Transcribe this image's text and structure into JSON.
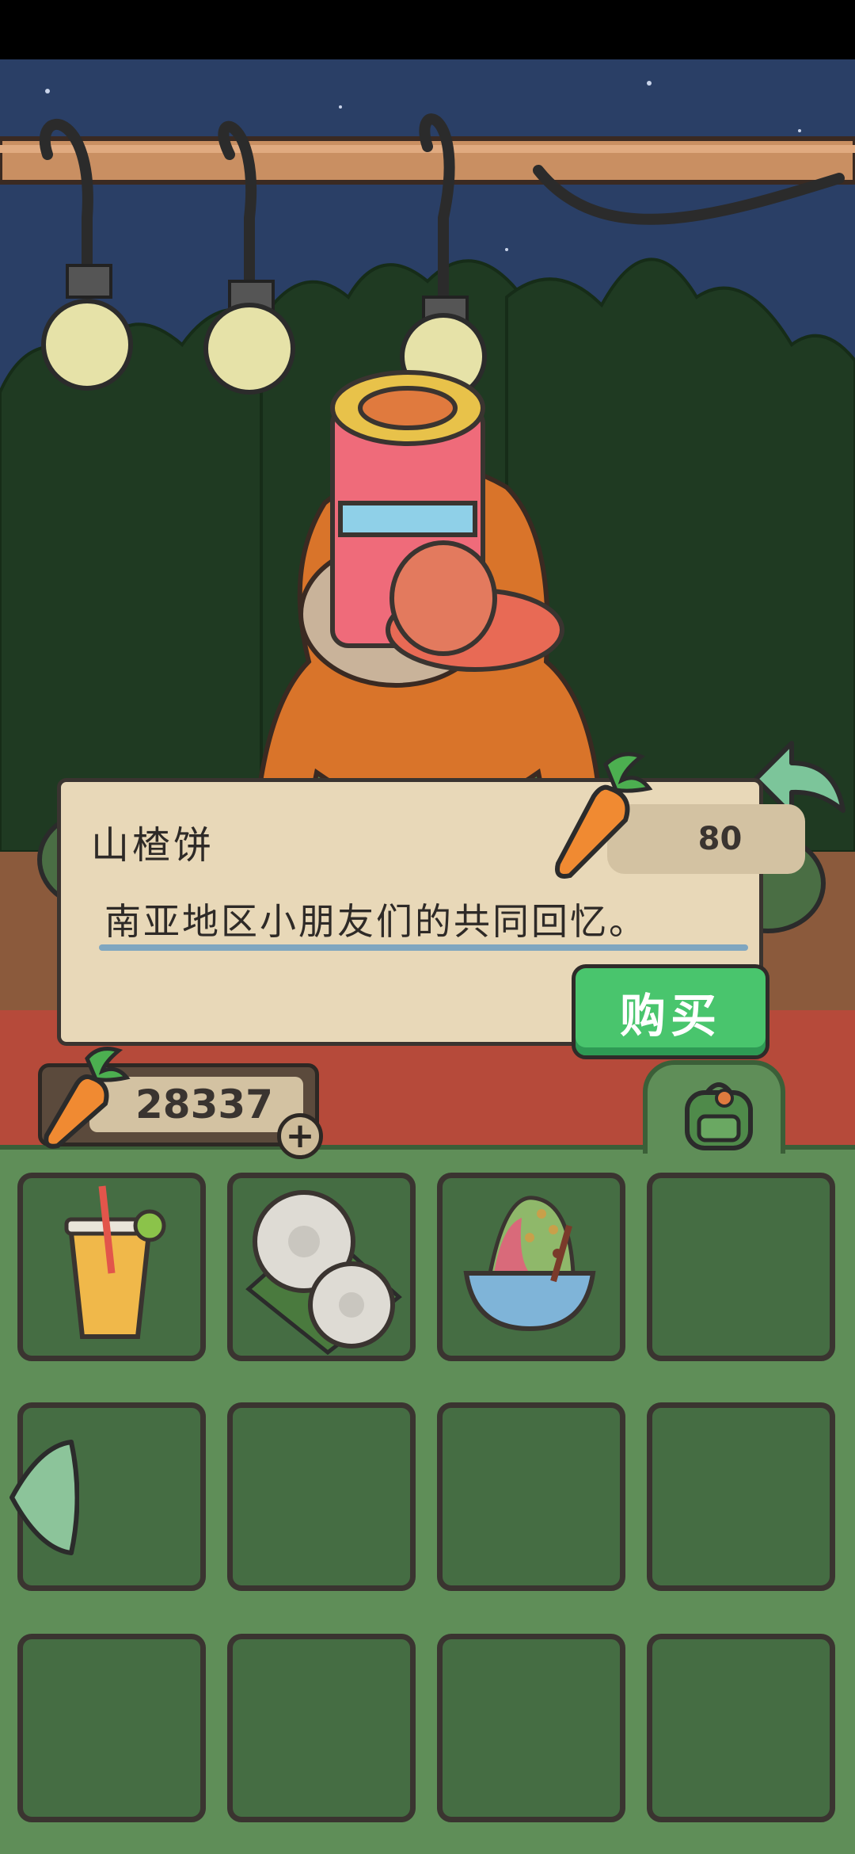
{
  "shop": {
    "item_name": "山楂饼",
    "item_price": "80",
    "item_description": "南亚地区小朋友们的共同回忆。",
    "buy_label": "购买"
  },
  "wallet": {
    "carrots": "28337"
  },
  "icons": {
    "carrot": "carrot-icon",
    "back": "back-arrow-icon",
    "plus": "plus-icon",
    "backpack": "backpack-icon",
    "page_left": "left-arrow-icon"
  },
  "inventory": {
    "slots": [
      "iced-drink",
      "steamed-buns",
      "shaved-ice-dessert",
      "",
      "",
      "",
      "",
      "",
      "",
      "",
      "",
      ""
    ]
  },
  "colors": {
    "buy_button": "#49c56d",
    "dialog_bg": "#e8d8b8",
    "inventory_bg": "#5f8e58",
    "slot_bg": "#456d43"
  }
}
